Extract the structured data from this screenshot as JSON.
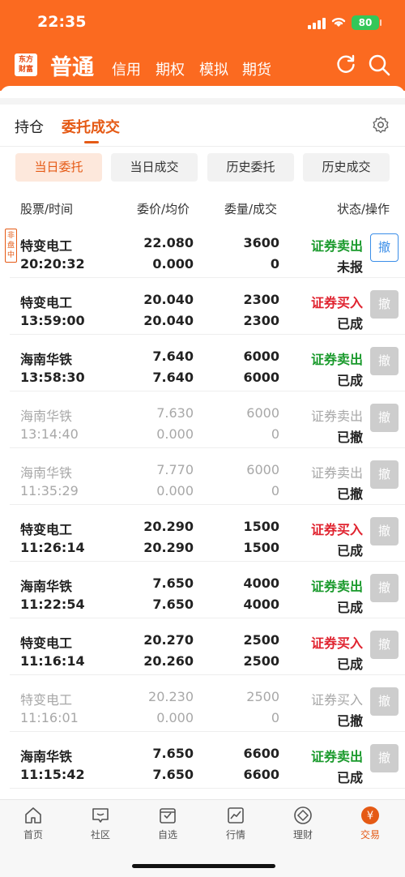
{
  "status_bar": {
    "time": "22:35",
    "battery": "80"
  },
  "header": {
    "logo_line1": "东方",
    "logo_line2": "财富",
    "account_type": "普通",
    "nav": [
      "信用",
      "期权",
      "模拟",
      "期货"
    ],
    "brand_color": "#fb6a20"
  },
  "tabs": {
    "positions": "持仓",
    "orders": "委托成交"
  },
  "segments": [
    "当日委托",
    "当日成交",
    "历史委托",
    "历史成交"
  ],
  "columns": {
    "stock_time": "股票/时间",
    "price_avg": "委价/均价",
    "qty_filled": "委量/成交",
    "status_action": "状态/操作"
  },
  "orders": [
    {
      "name": "特变电工",
      "time": "20:20:32",
      "price": "22.080",
      "avg": "0.000",
      "qty": "3600",
      "filled": "0",
      "direction": "证券卖出",
      "side": "sell",
      "status": "未报",
      "cancelled": false,
      "cancel_label": "撤",
      "cancel_active": true,
      "badge": "非盘中"
    },
    {
      "name": "特变电工",
      "time": "13:59:00",
      "price": "20.040",
      "avg": "20.040",
      "qty": "2300",
      "filled": "2300",
      "direction": "证券买入",
      "side": "buy",
      "status": "已成",
      "cancelled": false,
      "cancel_label": "撤",
      "cancel_active": false
    },
    {
      "name": "海南华铁",
      "time": "13:58:30",
      "price": "7.640",
      "avg": "7.640",
      "qty": "6000",
      "filled": "6000",
      "direction": "证券卖出",
      "side": "sell",
      "status": "已成",
      "cancelled": false,
      "cancel_label": "撤",
      "cancel_active": false
    },
    {
      "name": "海南华铁",
      "time": "13:14:40",
      "price": "7.630",
      "avg": "0.000",
      "qty": "6000",
      "filled": "0",
      "direction": "证券卖出",
      "side": "sell",
      "status": "已撤",
      "cancelled": true,
      "cancel_label": "撤",
      "cancel_active": false
    },
    {
      "name": "海南华铁",
      "time": "11:35:29",
      "price": "7.770",
      "avg": "0.000",
      "qty": "6000",
      "filled": "0",
      "direction": "证券卖出",
      "side": "sell",
      "status": "已撤",
      "cancelled": true,
      "cancel_label": "撤",
      "cancel_active": false
    },
    {
      "name": "特变电工",
      "time": "11:26:14",
      "price": "20.290",
      "avg": "20.290",
      "qty": "1500",
      "filled": "1500",
      "direction": "证券买入",
      "side": "buy",
      "status": "已成",
      "cancelled": false,
      "cancel_label": "撤",
      "cancel_active": false
    },
    {
      "name": "海南华铁",
      "time": "11:22:54",
      "price": "7.650",
      "avg": "7.650",
      "qty": "4000",
      "filled": "4000",
      "direction": "证券卖出",
      "side": "sell",
      "status": "已成",
      "cancelled": false,
      "cancel_label": "撤",
      "cancel_active": false
    },
    {
      "name": "特变电工",
      "time": "11:16:14",
      "price": "20.270",
      "avg": "20.260",
      "qty": "2500",
      "filled": "2500",
      "direction": "证券买入",
      "side": "buy",
      "status": "已成",
      "cancelled": false,
      "cancel_label": "撤",
      "cancel_active": false
    },
    {
      "name": "特变电工",
      "time": "11:16:01",
      "price": "20.230",
      "avg": "0.000",
      "qty": "2500",
      "filled": "0",
      "direction": "证券买入",
      "side": "buy",
      "status": "已撤",
      "cancelled": true,
      "cancel_label": "撤",
      "cancel_active": false
    },
    {
      "name": "海南华铁",
      "time": "11:15:42",
      "price": "7.650",
      "avg": "7.650",
      "qty": "6600",
      "filled": "6600",
      "direction": "证券卖出",
      "side": "sell",
      "status": "已成",
      "cancelled": false,
      "cancel_label": "撤",
      "cancel_active": false
    }
  ],
  "bottom_nav": [
    {
      "label": "首页",
      "icon": "home-icon"
    },
    {
      "label": "社区",
      "icon": "community-icon"
    },
    {
      "label": "自选",
      "icon": "watchlist-icon"
    },
    {
      "label": "行情",
      "icon": "market-icon"
    },
    {
      "label": "理财",
      "icon": "wealth-icon"
    },
    {
      "label": "交易",
      "icon": "trade-icon",
      "active": true
    }
  ]
}
